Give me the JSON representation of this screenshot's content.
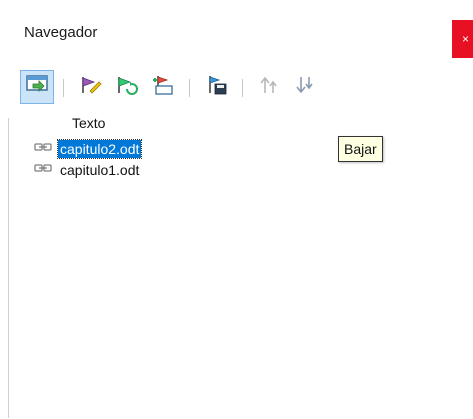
{
  "window": {
    "title": "Navegador",
    "close_glyph": "×"
  },
  "toolbar": {
    "buttons": [
      {
        "icon": "toggle-view-icon",
        "active": true
      },
      {
        "icon": "edit-icon",
        "active": false
      },
      {
        "icon": "update-icon",
        "active": false
      },
      {
        "icon": "insert-icon",
        "active": false
      },
      {
        "icon": "save-as-icon",
        "active": false
      },
      {
        "icon": "move-up-icon",
        "active": false
      },
      {
        "icon": "move-down-icon",
        "active": false
      }
    ],
    "tooltip": "Bajar"
  },
  "tree": {
    "root_label": "Texto",
    "items": [
      {
        "label": "capitulo2.odt",
        "icon": "link-icon",
        "selected": true
      },
      {
        "label": "capitulo1.odt",
        "icon": "link-icon",
        "selected": false
      }
    ]
  },
  "colors": {
    "accent": "#0078d7",
    "close_button": "#e81123",
    "tooltip_bg": "#ffffe1",
    "active_button_bg": "#cce4f7"
  }
}
